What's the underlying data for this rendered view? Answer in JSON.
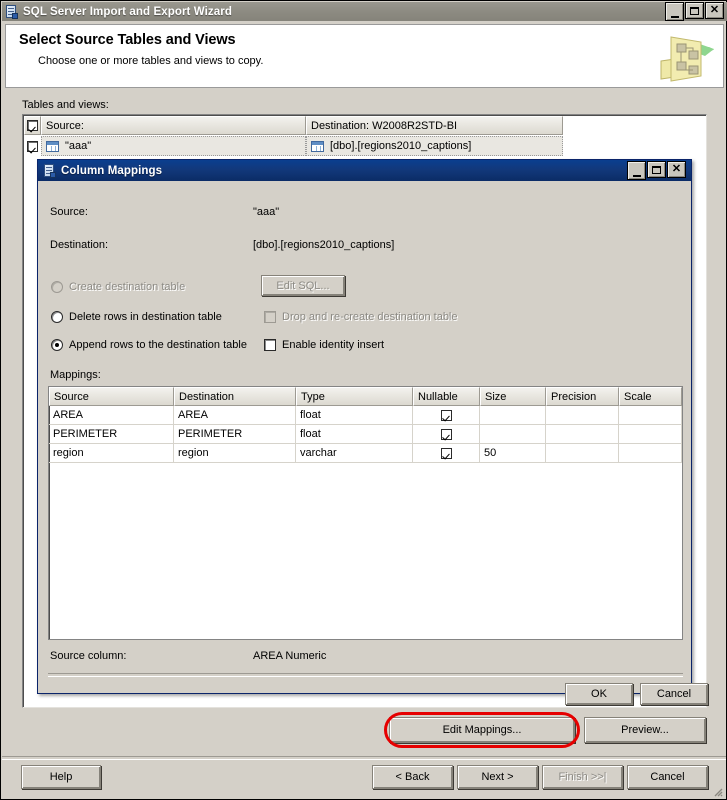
{
  "window": {
    "title": "SQL Server Import and Export Wizard",
    "icon": "wizard-app-icon",
    "buttons": {
      "minimize": "_",
      "maximize": "□",
      "close": "✕"
    }
  },
  "header": {
    "title": "Select Source Tables and Views",
    "subtitle": "Choose one or more tables and views to copy.",
    "icon": "data-flow-icon"
  },
  "tables_and_views": {
    "label": "Tables and views:",
    "columns": {
      "select_all": "",
      "source": "Source:",
      "destination": "Destination: W2008R2STD-BI"
    },
    "rows": [
      {
        "checked": true,
        "source": "\"aaa\"",
        "destination": "[dbo].[regions2010_captions]"
      }
    ]
  },
  "dialog": {
    "title": "Column Mappings",
    "icon": "column-mappings-icon",
    "buttons": {
      "minimize": "_",
      "maximize": "□",
      "close": "✕"
    },
    "source_label": "Source:",
    "source_value": "\"aaa\"",
    "destination_label": "Destination:",
    "destination_value": "[dbo].[regions2010_captions]",
    "options": [
      {
        "label": "Create destination table",
        "selected": false,
        "disabled": true
      },
      {
        "label": "Delete rows in destination table",
        "selected": false,
        "disabled": false
      },
      {
        "label": "Append rows to the destination table",
        "selected": true,
        "disabled": false
      }
    ],
    "edit_sql_button": "Edit SQL...",
    "checkboxes": [
      {
        "label": "Drop and re-create destination table",
        "checked": false,
        "disabled": true
      },
      {
        "label": "Enable identity insert",
        "checked": false,
        "disabled": false
      }
    ],
    "mappings_label": "Mappings:",
    "mappings_columns": [
      "Source",
      "Destination",
      "Type",
      "Nullable",
      "Size",
      "Precision",
      "Scale"
    ],
    "mappings_rows": [
      {
        "source": "AREA",
        "destination": "AREA",
        "type": "float",
        "nullable": true,
        "size": "",
        "precision": "",
        "scale": ""
      },
      {
        "source": "PERIMETER",
        "destination": "PERIMETER",
        "type": "float",
        "nullable": true,
        "size": "",
        "precision": "",
        "scale": ""
      },
      {
        "source": "region",
        "destination": "region",
        "type": "varchar",
        "nullable": true,
        "size": "50",
        "precision": "",
        "scale": ""
      }
    ],
    "source_column_label": "Source column:",
    "source_column_value": "AREA Numeric",
    "ok_button": "OK",
    "cancel_button": "Cancel"
  },
  "panel_buttons": {
    "edit_mappings": "Edit Mappings...",
    "preview": "Preview...",
    "highlight_color": "#e60000"
  },
  "wizard_buttons": {
    "help": "Help",
    "back": "< Back",
    "next": "Next >",
    "finish": "Finish >>|",
    "cancel": "Cancel",
    "finish_disabled": true
  }
}
